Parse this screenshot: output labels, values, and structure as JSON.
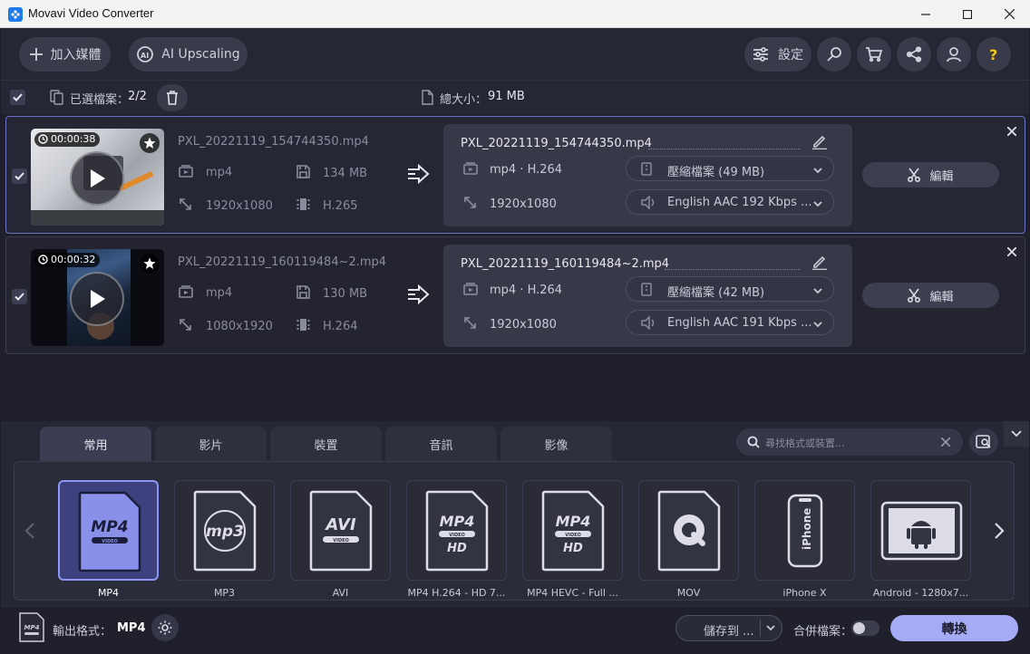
{
  "window": {
    "title": "Movavi Video Converter"
  },
  "toolbar": {
    "add_media": "加入媒體",
    "ai_upscaling": "AI Upscaling",
    "settings": "設定"
  },
  "selection": {
    "label": "已選檔案：",
    "count": "2/2",
    "total_label": "總大小：",
    "total_size": "91 MB"
  },
  "files": [
    {
      "duration": "00:00:38",
      "source_name": "PXL_20221119_154744350.mp4",
      "source_format": "mp4",
      "source_size": "134 MB",
      "source_resolution": "1920x1080",
      "source_codec": "H.265",
      "output_name": "PXL_20221119_154744350.mp4",
      "output_format": "mp4 · H.264",
      "output_resolution": "1920x1080",
      "compression": "壓縮檔案 (49 MB)",
      "audio": "English AAC 192 Kbps ...",
      "edit_label": "編輯"
    },
    {
      "duration": "00:00:32",
      "source_name": "PXL_20221119_160119484~2.mp4",
      "source_format": "mp4",
      "source_size": "130 MB",
      "source_resolution": "1080x1920",
      "source_codec": "H.264",
      "output_name": "PXL_20221119_160119484~2.mp4",
      "output_format": "mp4 · H.264",
      "output_resolution": "1920x1080",
      "compression": "壓縮檔案 (42 MB)",
      "audio": "English AAC 191 Kbps ...",
      "edit_label": "編輯"
    }
  ],
  "tabs": [
    "常用",
    "影片",
    "裝置",
    "音訊",
    "影像"
  ],
  "search": {
    "placeholder": "尋找格式或裝置..."
  },
  "formats": [
    {
      "label": "MP4",
      "icon": "mp4-file-icon"
    },
    {
      "label": "MP3",
      "icon": "mp3-file-icon"
    },
    {
      "label": "AVI",
      "icon": "avi-file-icon"
    },
    {
      "label": "MP4 H.264 - HD 7...",
      "icon": "mp4-hd-file-icon"
    },
    {
      "label": "MP4 HEVC - Full ...",
      "icon": "mp4-hd-file-icon"
    },
    {
      "label": "MOV",
      "icon": "quicktime-file-icon"
    },
    {
      "label": "iPhone X",
      "icon": "iphone-icon"
    },
    {
      "label": "Android - 1280x7...",
      "icon": "android-tablet-icon"
    }
  ],
  "footer": {
    "output_label": "輸出格式：",
    "output_format": "MP4",
    "save_to": "儲存到 ...",
    "merge_label": "合併檔案：",
    "convert": "轉換"
  },
  "colors": {
    "accent": "#a5acf5",
    "selected_tile": "#3d427e",
    "background": "#1f202b"
  }
}
